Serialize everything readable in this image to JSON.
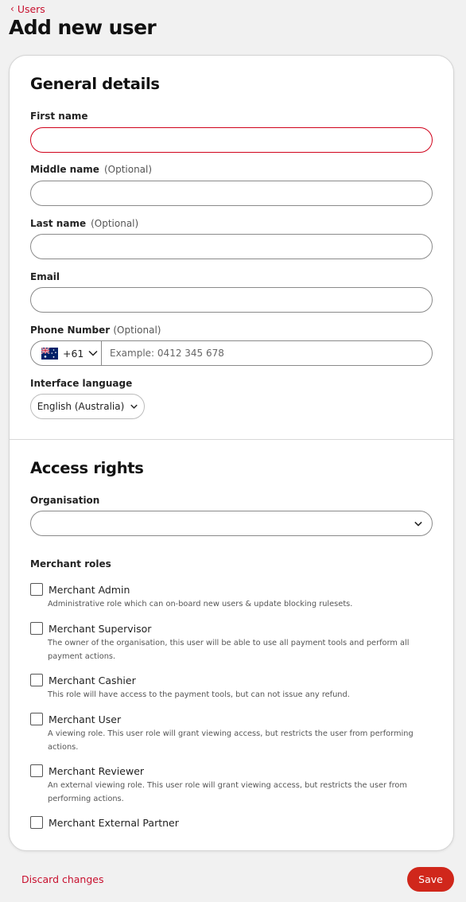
{
  "breadcrumb": {
    "label": "Users"
  },
  "page": {
    "title": "Add new user"
  },
  "general": {
    "title": "General details",
    "first_name": {
      "label": "First name",
      "value": ""
    },
    "middle_name": {
      "label": "Middle name",
      "optional": "(Optional)",
      "value": ""
    },
    "last_name": {
      "label": "Last name",
      "optional": "(Optional)",
      "value": ""
    },
    "email": {
      "label": "Email",
      "value": ""
    },
    "phone": {
      "label": "Phone Number",
      "optional": "(Optional)",
      "country_code": "+61",
      "country_flag": "australia-flag",
      "placeholder": "Example: 0412 345 678",
      "value": ""
    },
    "language": {
      "label": "Interface language",
      "value": "English (Australia)"
    }
  },
  "access": {
    "title": "Access rights",
    "organisation": {
      "label": "Organisation",
      "value": ""
    },
    "roles_label": "Merchant roles",
    "roles": [
      {
        "name": "Merchant Admin",
        "description": "Administrative role which can on-board new users & update blocking rulesets.",
        "checked": false
      },
      {
        "name": "Merchant Supervisor",
        "description": "The owner of the organisation, this user will be able to use all payment tools and perform all payment actions.",
        "checked": false
      },
      {
        "name": "Merchant Cashier",
        "description": "This role will have access to the payment tools, but can not issue any refund.",
        "checked": false
      },
      {
        "name": "Merchant User",
        "description": "A viewing role. This user role will grant viewing access, but restricts the user from performing actions.",
        "checked": false
      },
      {
        "name": "Merchant Reviewer",
        "description": "An external viewing role. This user role will grant viewing access, but restricts the user from performing actions.",
        "checked": false
      },
      {
        "name": "Merchant External Partner",
        "description": "",
        "checked": false
      }
    ]
  },
  "footer": {
    "discard_label": "Discard changes",
    "save_label": "Save"
  },
  "colors": {
    "accent": "#c8102e",
    "save_bg": "#d0271b",
    "error_border": "#d0021b"
  }
}
